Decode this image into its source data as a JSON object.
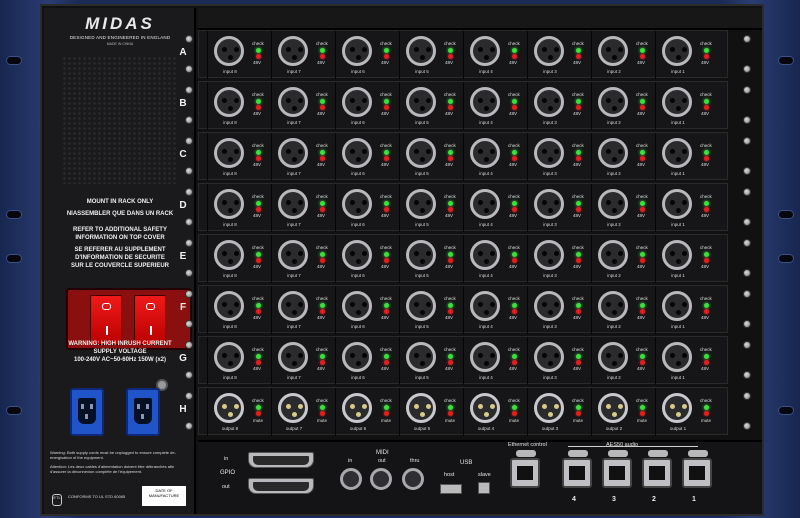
{
  "brand": {
    "logo": "MIDAS",
    "tagline": "DESIGNED AND ENGINEERED IN ENGLAND",
    "made_in": "MADE IN CHINA"
  },
  "psu_panel": {
    "warnings": [
      "MOUNT IN RACK ONLY",
      "NIASSEMBLER QUE DANS UN RACK",
      "REFER TO ADDITIONAL SAFETY",
      "INFORMATION ON TOP COVER",
      "SE REFERER AU SUPPLEMENT",
      "D'INFORMATION DE SECURITE",
      "SUR LE COUVERCLE SUPERIEUR"
    ],
    "inrush_warning": [
      "WARNING: HIGH INRUSH CURRENT",
      "SUPPLY VOLTAGE",
      "100-240V  AC~50-60Hz 150W (x2)"
    ],
    "footer_note": "Warning: Both supply cords must be unplugged to ensure complete de-energisation of the equipment.",
    "footer_note_fr": "Attention: Les deux cables d'alimentation doivent être débranchés afin d'assurer la déconnexion complète de l'équipement.",
    "cert_text": "CONFORMS TO UL STD 60065",
    "date_label": "DATE OF MANUFACTURE"
  },
  "card_rows": [
    {
      "letter": "A",
      "type": "input"
    },
    {
      "letter": "B",
      "type": "input"
    },
    {
      "letter": "C",
      "type": "input"
    },
    {
      "letter": "D",
      "type": "input"
    },
    {
      "letter": "E",
      "type": "input"
    },
    {
      "letter": "F",
      "type": "input"
    },
    {
      "letter": "G",
      "type": "input"
    },
    {
      "letter": "H",
      "type": "output"
    }
  ],
  "input_labels": [
    "input 8",
    "input 7",
    "input 6",
    "input 5",
    "input 4",
    "input 3",
    "input 2",
    "input 1"
  ],
  "output_labels": [
    "output 8",
    "output 7",
    "output 6",
    "output 5",
    "output 4",
    "output 3",
    "output 2",
    "output 1"
  ],
  "indicator_labels": {
    "check": "check",
    "phantom": "48V",
    "mute": "mute"
  },
  "connectors": {
    "gpio": {
      "label": "GPIO",
      "in": "in",
      "out": "out"
    },
    "midi": {
      "label": "MIDI",
      "ports": [
        "in",
        "out",
        "thru"
      ]
    },
    "usb": {
      "label": "USB",
      "host": "host",
      "slave": "slave"
    },
    "ethernet_label": "Ethernet control",
    "aes50_label": "AES50 audio",
    "aes50_numbers": [
      "4",
      "3",
      "2",
      "1"
    ]
  },
  "colors": {
    "rack_blue": "#1c2b55",
    "led_green": "#3ce03c",
    "led_red": "#e02020",
    "switch_red": "#e01010",
    "iec_blue": "#1f55c9"
  }
}
